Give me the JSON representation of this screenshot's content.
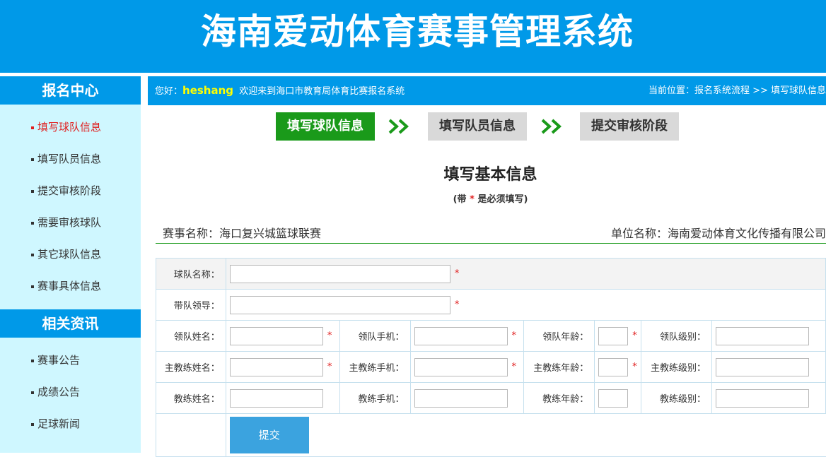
{
  "header": {
    "title": "海南爱动体育赛事管理系统"
  },
  "sidebar": {
    "section1": {
      "title": "报名中心",
      "items": [
        "填写球队信息",
        "填写队员信息",
        "提交审核阶段",
        "需要审核球队",
        "其它球队信息",
        "赛事具体信息"
      ]
    },
    "section2": {
      "title": "相关资讯",
      "items": [
        "赛事公告",
        "成绩公告",
        "足球新闻"
      ]
    }
  },
  "topbar": {
    "greet_prefix": "您好：",
    "user": "heshang",
    "welcome": "欢迎来到海口市教育局体育比赛报名系统",
    "location": "当前位置：报名系统流程 >> 填写球队信息"
  },
  "steps": [
    {
      "label": "填写球队信息",
      "active": true
    },
    {
      "label": "填写队员信息",
      "active": false
    },
    {
      "label": "提交审核阶段",
      "active": false
    }
  ],
  "form": {
    "title": "填写基本信息",
    "subtitle_pre": "(带",
    "subtitle_star": "*",
    "subtitle_post": "是必须填写)",
    "event_name": "赛事名称：海口复兴城篮球联赛",
    "org_name": "单位名称：海南爱动体育文化传播有限公司",
    "labels": {
      "team_name": "球队名称：",
      "leader": "带队领导：",
      "captain_name": "领队姓名：",
      "captain_phone": "领队手机：",
      "captain_age": "领队年龄：",
      "captain_level": "领队级别：",
      "head_coach_name": "主教练姓名：",
      "head_coach_phone": "主教练手机：",
      "head_coach_age": "主教练年龄：",
      "head_coach_level": "主教练级别：",
      "coach_name": "教练姓名：",
      "coach_phone": "教练手机：",
      "coach_age": "教练年龄：",
      "coach_level": "教练级别："
    },
    "required_mark": "*",
    "submit_label": "提交"
  }
}
